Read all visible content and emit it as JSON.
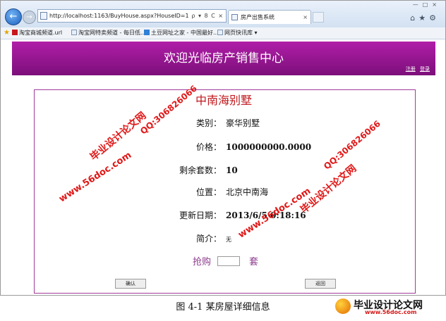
{
  "browser": {
    "url": "http://localhost:1163/BuyHouse.aspx?HouseID=1",
    "address_tools": "ρ ▾ 8 C ×",
    "tab_title": "房产出售系统",
    "favorites": [
      "淘宝商城频道.url",
      "淘宝网特卖频道 - 每日低...",
      "土豆网址之家 - 中国最好...",
      "网页快讯库 ▾"
    ]
  },
  "header": {
    "title": "欢迎光临房产销售中心",
    "register": "注册",
    "login": "登录"
  },
  "house": {
    "name": "中南海别墅",
    "fields": [
      {
        "label": "类别：",
        "value": "豪华别墅"
      },
      {
        "label": "价格：",
        "value": "1000000000.0000"
      },
      {
        "label": "剩余套数：",
        "value": "10"
      },
      {
        "label": "位置：",
        "value": "北京中南海"
      },
      {
        "label": "更新日期：",
        "value": "2013/6/5 0:18:16"
      },
      {
        "label": "简介：",
        "value": "无"
      }
    ]
  },
  "purchase": {
    "label": "抢购",
    "unit": "套",
    "quantity": ""
  },
  "buttons": {
    "confirm": "确认",
    "back": "返回"
  },
  "watermarks": {
    "site_name": "毕业设计论文网",
    "url": "www.56doc.com",
    "qq": "QQ:306826066"
  },
  "caption": "图 4-1 某房屋详细信息",
  "logo": {
    "name": "毕业设计论文网",
    "url": "www.56doc.com"
  }
}
